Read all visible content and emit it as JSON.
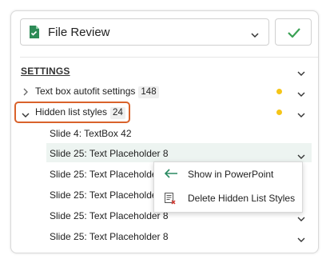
{
  "header": {
    "title": "File Review",
    "file_icon": "document-icon",
    "confirm_icon": "checkmark-icon",
    "accent": "#3aa154"
  },
  "section": {
    "title": "SETTINGS"
  },
  "tree": [
    {
      "label": "Text box autofit settings",
      "count": "148",
      "expanded": false
    },
    {
      "label": "Hidden list styles",
      "count": "24",
      "expanded": true
    }
  ],
  "items": [
    "Slide 4: TextBox 42",
    "Slide 25: Text Placeholder 8",
    "Slide 25: Text Placeholder 8",
    "Slide 25: Text Placeholder 8",
    "Slide 25: Text Placeholder 8",
    "Slide 25: Text Placeholder 8"
  ],
  "context_menu": {
    "items": [
      {
        "label": "Show in PowerPoint",
        "icon": "arrow-left-icon"
      },
      {
        "label": "Delete Hidden List Styles",
        "icon": "delete-list-icon"
      }
    ]
  },
  "colors": {
    "warning_dot": "#f5c518",
    "highlight_border": "#d9622b",
    "selected_row": "#edf4f1",
    "arrow": "#2a8a62"
  }
}
